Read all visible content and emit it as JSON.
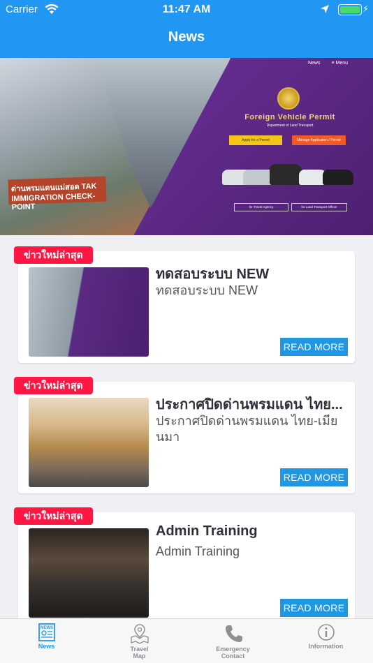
{
  "status_bar": {
    "carrier": "Carrier",
    "time": "11:47 AM"
  },
  "nav": {
    "title": "News"
  },
  "hero": {
    "menu_news": "News",
    "menu_menu": "≡ Menu",
    "permit_title": "Foreign Vehicle Permit",
    "permit_subtitle": "Department of Land Transport",
    "apply_label": "Apply for a Permit",
    "manage_label": "Manage Application / Permit",
    "agency_label": "for Travel Agency",
    "officer_label": "for Land Transport Officer",
    "sign_text": "ด่านพรมแดนแม่สอด TAK IMMIGRATION CHECK-POINT"
  },
  "news": [
    {
      "badge": "ข่าวใหม่ล่าสุด",
      "title": "ทดสอบระบบ NEW",
      "subtitle": "ทดสอบระบบ NEW",
      "read_more": "READ MORE"
    },
    {
      "badge": "ข่าวใหม่ล่าสุด",
      "title": "ประกาศปิดด่านพรมแดน ไทย...",
      "subtitle": "ประกาศปิดด่านพรมแดน ไทย-เมียนมา",
      "read_more": "READ MORE"
    },
    {
      "badge": "ข่าวใหม่ล่าสุด",
      "title": "Admin Training",
      "subtitle": "Admin Training",
      "read_more": "READ MORE"
    }
  ],
  "tabs": [
    {
      "label": "News",
      "icon": "newspaper-icon",
      "active": true
    },
    {
      "label": "Travel\nMap",
      "icon": "map-pin-icon",
      "active": false
    },
    {
      "label": "Emergency\nContact",
      "icon": "phone-icon",
      "active": false
    },
    {
      "label": "Information",
      "icon": "info-icon",
      "active": false
    }
  ],
  "colors": {
    "accent": "#2196f3",
    "badge": "#ff1744",
    "read_more": "#2196e3",
    "battery": "#4cd964"
  }
}
